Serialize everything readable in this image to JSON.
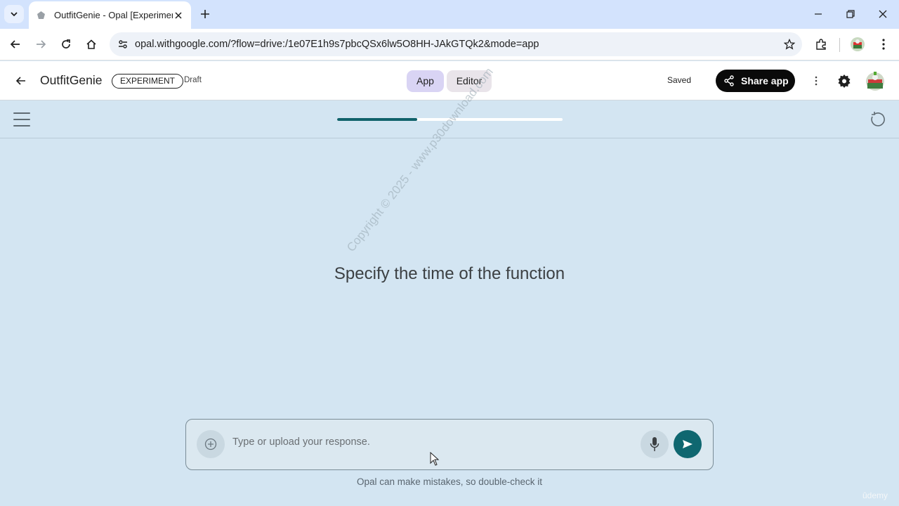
{
  "browser": {
    "tab_title": "OutfitGenie - Opal [Experiment]",
    "url": "opal.withgoogle.com/?flow=drive:/1e07E1h9s7pbcQSx6lw5O8HH-JAkGTQk2&mode=app"
  },
  "app": {
    "title": "OutfitGenie",
    "badge": "EXPERIMENT",
    "status": "Draft",
    "modes": [
      "App",
      "Editor"
    ],
    "active_mode": "App",
    "saved_label": "Saved",
    "share_label": "Share app"
  },
  "progress": {
    "fraction": 0.355
  },
  "main": {
    "prompt": "Specify the time of the function",
    "watermark": "Copyright © 2025 - www.p30download.com"
  },
  "composer": {
    "placeholder": "Type or upload your response.",
    "value": ""
  },
  "footer": {
    "disclaimer": "Opal can make mistakes, so double-check it",
    "corner_mark": "ûdemy"
  },
  "colors": {
    "accent": "#10626b",
    "background": "#d3e5f2",
    "tabstrip": "#d3e3fd",
    "share_button": "#0a0a0a"
  },
  "icons": [
    "tab-search-icon",
    "favicon-icon",
    "close-icon",
    "plus-icon",
    "minimize-icon",
    "restore-icon",
    "window-close-icon",
    "back-arrow-icon",
    "forward-arrow-icon",
    "reload-icon",
    "home-icon",
    "site-settings-icon",
    "star-icon",
    "extensions-icon",
    "profile-avatar-icon",
    "kebab-menu-icon",
    "share-icon",
    "gear-icon",
    "hamburger-menu-icon",
    "restart-icon",
    "add-circle-icon",
    "microphone-icon",
    "send-icon",
    "mouse-cursor-icon"
  ]
}
